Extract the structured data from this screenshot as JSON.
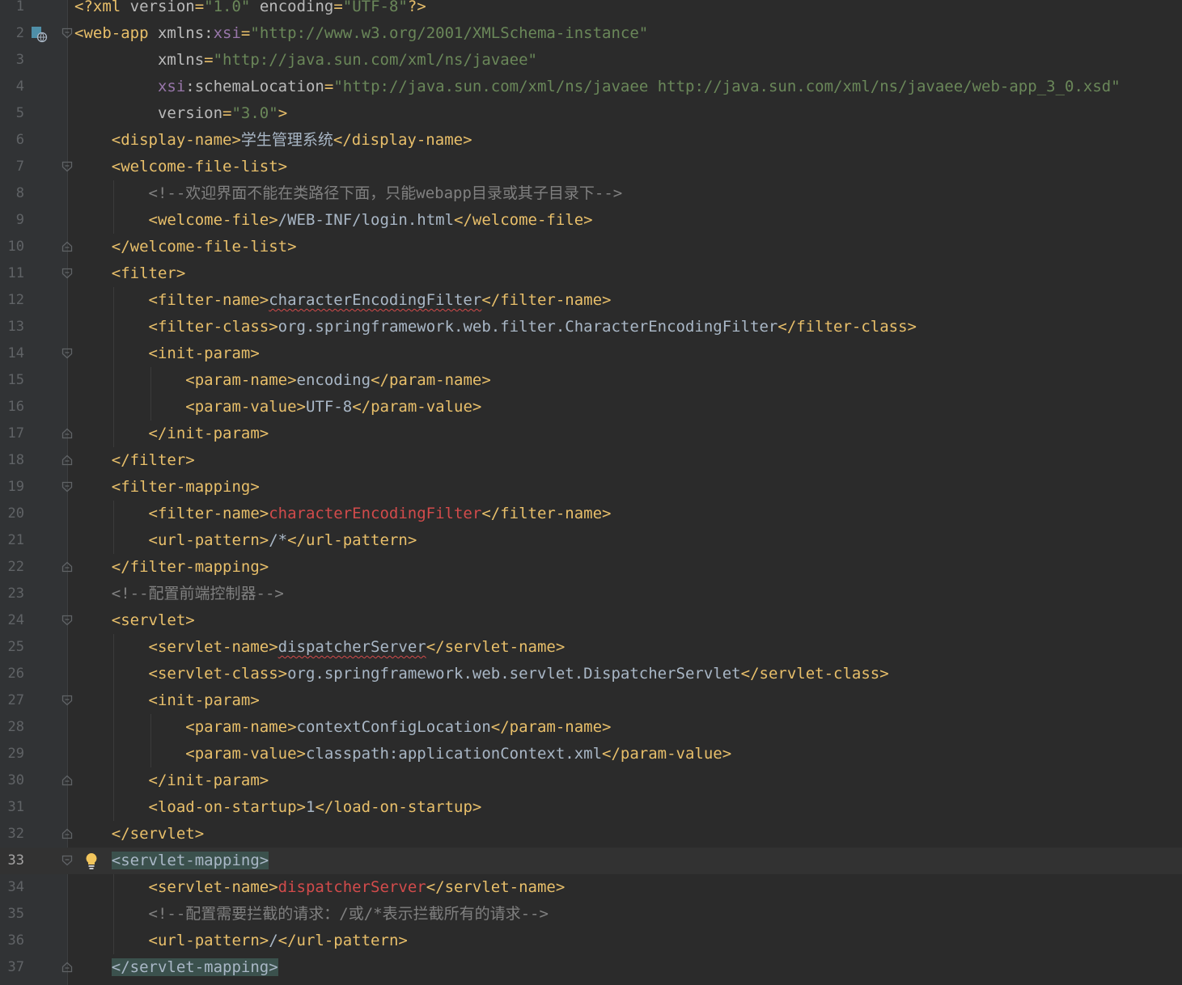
{
  "colors": {
    "background": "#2b2b2b",
    "gutter": "#313335",
    "tag": "#e8bf6a",
    "attribute_value": "#6a8759",
    "comment": "#808080",
    "error": "#d24b4b",
    "text": "#a9b7c6",
    "namespace": "#9876aa",
    "match_highlight": "#3b514d"
  },
  "editor": {
    "current_line": 33,
    "lines": [
      {
        "n": "1",
        "parts": [
          [
            "t",
            "<?xml "
          ],
          [
            "an",
            "version"
          ],
          [
            "t",
            "="
          ],
          [
            "av",
            "\"1.0\""
          ],
          [
            "an",
            " encoding"
          ],
          [
            "t",
            "="
          ],
          [
            "av",
            "\"UTF-8\""
          ],
          [
            "t",
            "?>"
          ]
        ]
      },
      {
        "n": "2",
        "fold": "open",
        "parts": [
          [
            "t",
            "<web-app "
          ],
          [
            "an",
            "xmlns:"
          ],
          [
            "ns",
            "xsi"
          ],
          [
            "t",
            "="
          ],
          [
            "av",
            "\"http://www.w3.org/2001/XMLSchema-instance\""
          ]
        ]
      },
      {
        "n": "3",
        "parts": [
          [
            "an",
            "         xmlns"
          ],
          [
            "t",
            "="
          ],
          [
            "av",
            "\"http://java.sun.com/xml/ns/javaee\""
          ]
        ]
      },
      {
        "n": "4",
        "parts": [
          [
            "ns",
            "         xsi"
          ],
          [
            "an",
            ":schemaLocation"
          ],
          [
            "t",
            "="
          ],
          [
            "av",
            "\"http://java.sun.com/xml/ns/javaee http://java.sun.com/xml/ns/javaee/web-app_3_0.xsd\""
          ]
        ]
      },
      {
        "n": "5",
        "parts": [
          [
            "an",
            "         version"
          ],
          [
            "t",
            "="
          ],
          [
            "av",
            "\"3.0\""
          ],
          [
            "t",
            ">"
          ]
        ]
      },
      {
        "n": "6",
        "parts": [
          [
            "t",
            "    <display-name>"
          ],
          [
            "tx",
            "学生管理系统"
          ],
          [
            "t",
            "</display-name>"
          ]
        ]
      },
      {
        "n": "7",
        "fold": "open",
        "parts": [
          [
            "t",
            "    <welcome-file-list>"
          ]
        ]
      },
      {
        "n": "8",
        "parts": [
          [
            "cm",
            "        <!--欢迎界面不能在类路径下面，只能webapp目录或其子目录下-->"
          ]
        ]
      },
      {
        "n": "9",
        "parts": [
          [
            "t",
            "        <welcome-file>"
          ],
          [
            "tx",
            "/WEB-INF/login.html"
          ],
          [
            "t",
            "</welcome-file>"
          ]
        ]
      },
      {
        "n": "10",
        "fold": "close",
        "parts": [
          [
            "t",
            "    </welcome-file-list>"
          ]
        ]
      },
      {
        "n": "11",
        "fold": "open",
        "parts": [
          [
            "t",
            "    <filter>"
          ]
        ]
      },
      {
        "n": "12",
        "parts": [
          [
            "t",
            "        <filter-name>"
          ],
          [
            "typo",
            "characterEncodingFilter"
          ],
          [
            "t",
            "</filter-name>"
          ]
        ]
      },
      {
        "n": "13",
        "parts": [
          [
            "t",
            "        <filter-class>"
          ],
          [
            "tx",
            "org.springframework.web.filter.CharacterEncodingFilter"
          ],
          [
            "t",
            "</filter-class>"
          ]
        ]
      },
      {
        "n": "14",
        "fold": "open",
        "parts": [
          [
            "t",
            "        <init-param>"
          ]
        ]
      },
      {
        "n": "15",
        "parts": [
          [
            "t",
            "            <param-name>"
          ],
          [
            "tx",
            "encoding"
          ],
          [
            "t",
            "</param-name>"
          ]
        ]
      },
      {
        "n": "16",
        "parts": [
          [
            "t",
            "            <param-value>"
          ],
          [
            "tx",
            "UTF-8"
          ],
          [
            "t",
            "</param-value>"
          ]
        ]
      },
      {
        "n": "17",
        "fold": "close",
        "parts": [
          [
            "t",
            "        </init-param>"
          ]
        ]
      },
      {
        "n": "18",
        "fold": "close",
        "parts": [
          [
            "t",
            "    </filter>"
          ]
        ]
      },
      {
        "n": "19",
        "fold": "open",
        "parts": [
          [
            "t",
            "    <filter-mapping>"
          ]
        ]
      },
      {
        "n": "20",
        "parts": [
          [
            "t",
            "        <filter-name>"
          ],
          [
            "err",
            "characterEncodingFilter"
          ],
          [
            "t",
            "</filter-name>"
          ]
        ]
      },
      {
        "n": "21",
        "parts": [
          [
            "t",
            "        <url-pattern>"
          ],
          [
            "tx",
            "/*"
          ],
          [
            "t",
            "</url-pattern>"
          ]
        ]
      },
      {
        "n": "22",
        "fold": "close",
        "parts": [
          [
            "t",
            "    </filter-mapping>"
          ]
        ]
      },
      {
        "n": "23",
        "parts": [
          [
            "cm",
            "    <!--配置前端控制器-->"
          ]
        ]
      },
      {
        "n": "24",
        "fold": "open",
        "parts": [
          [
            "t",
            "    <servlet>"
          ]
        ]
      },
      {
        "n": "25",
        "parts": [
          [
            "t",
            "        <servlet-name>"
          ],
          [
            "typo",
            "dispatcherServer"
          ],
          [
            "t",
            "</servlet-name>"
          ]
        ]
      },
      {
        "n": "26",
        "parts": [
          [
            "t",
            "        <servlet-class>"
          ],
          [
            "tx",
            "org.springframework.web.servlet.DispatcherServlet"
          ],
          [
            "t",
            "</servlet-class>"
          ]
        ]
      },
      {
        "n": "27",
        "fold": "open",
        "parts": [
          [
            "t",
            "        <init-param>"
          ]
        ]
      },
      {
        "n": "28",
        "parts": [
          [
            "t",
            "            <param-name>"
          ],
          [
            "tx",
            "contextConfigLocation"
          ],
          [
            "t",
            "</param-name>"
          ]
        ]
      },
      {
        "n": "29",
        "parts": [
          [
            "t",
            "            <param-value>"
          ],
          [
            "tx",
            "classpath:applicationContext.xml"
          ],
          [
            "t",
            "</param-value>"
          ]
        ]
      },
      {
        "n": "30",
        "fold": "close",
        "parts": [
          [
            "t",
            "        </init-param>"
          ]
        ]
      },
      {
        "n": "31",
        "parts": [
          [
            "t",
            "        <load-on-startup>"
          ],
          [
            "tx",
            "1"
          ],
          [
            "t",
            "</load-on-startup>"
          ]
        ]
      },
      {
        "n": "32",
        "fold": "close",
        "parts": [
          [
            "t",
            "    </servlet>"
          ]
        ]
      },
      {
        "n": "33",
        "fold": "open",
        "bulb": true,
        "parts": [
          [
            "tx",
            "    "
          ],
          [
            "match",
            "<servlet-mapping>"
          ]
        ]
      },
      {
        "n": "34",
        "parts": [
          [
            "t",
            "        <servlet-name>"
          ],
          [
            "err",
            "dispatcherServer"
          ],
          [
            "t",
            "</servlet-name>"
          ]
        ]
      },
      {
        "n": "35",
        "parts": [
          [
            "cm",
            "        <!--配置需要拦截的请求：/或/*表示拦截所有的请求-->"
          ]
        ]
      },
      {
        "n": "36",
        "parts": [
          [
            "t",
            "        <url-pattern>"
          ],
          [
            "tx",
            "/"
          ],
          [
            "t",
            "</url-pattern>"
          ]
        ]
      },
      {
        "n": "37",
        "fold": "close",
        "parts": [
          [
            "tx",
            "    "
          ],
          [
            "match",
            "</servlet-mapping>"
          ]
        ]
      }
    ]
  }
}
